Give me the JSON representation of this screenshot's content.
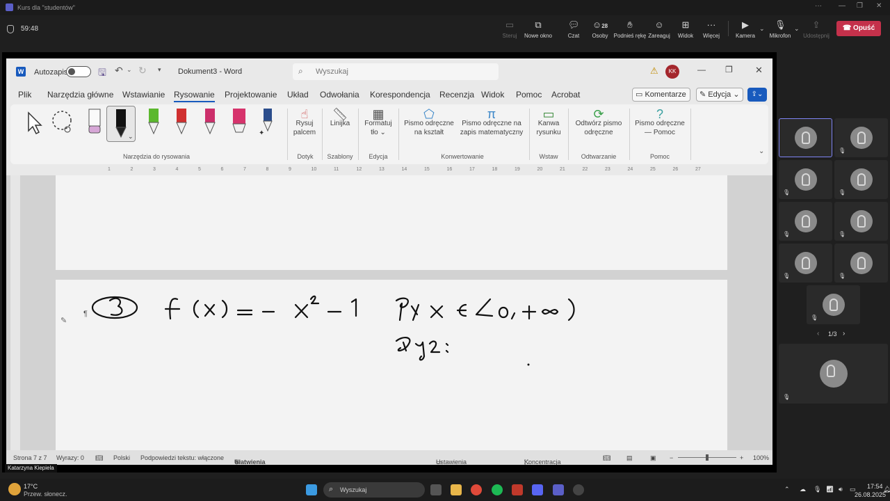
{
  "teams": {
    "window_title": "Kurs dla \"studentów\"",
    "timer": "59:48",
    "buttons": {
      "share": "Steruj",
      "new_window": "Nowe okno",
      "chat": "Czat",
      "people": "Osoby",
      "people_count": "28",
      "raise_hand": "Podnieś rękę",
      "react": "Zareaguj",
      "view": "Widok",
      "more": "Więcej",
      "camera": "Kamera",
      "mic": "Mikrofon",
      "share_tray": "Udostępnij",
      "leave": "Opuść"
    },
    "presenter_name": "Katarzyna Kiepiela",
    "pager": "1/3"
  },
  "word": {
    "autosave_label": "Autozapis",
    "doc_title": "Dokument3",
    "app_name": "Word",
    "search_placeholder": "Wyszukaj",
    "user_initials": "KK",
    "tabs": [
      "Plik",
      "Narzędzia główne",
      "Wstawianie",
      "Rysowanie",
      "Projektowanie",
      "Układ",
      "Odwołania",
      "Korespondencja",
      "Recenzja",
      "Widok",
      "Pomoc",
      "Acrobat"
    ],
    "active_tab": "Rysowanie",
    "comments_button": "Komentarze",
    "editing_button": "Edycja",
    "ribbon": {
      "draw_with_touch": "Rysuj palcem",
      "ruler": "Linijka",
      "format_background": "Formatuj tło",
      "ink_to_shape": "Pismo odręczne na kształt",
      "ink_to_math": "Pismo odręczne na zapis matematyczny",
      "drawing_canvas": "Kanwa rysunku",
      "ink_replay": "Odtwórz pismo odręczne",
      "ink_help": "Pismo odręczne — Pomoc",
      "groups": {
        "drawing_tools": "Narzędzia do rysowania",
        "touch": "Dotyk",
        "stencils": "Szablony",
        "edit": "Edycja",
        "convert": "Konwertowanie",
        "insert": "Wstaw",
        "replay": "Odtwarzanie",
        "help": "Pomoc"
      }
    },
    "ruler_numbers": [
      "1",
      "2",
      "3",
      "4",
      "5",
      "6",
      "7",
      "8",
      "9",
      "10",
      "11",
      "12",
      "13",
      "14",
      "15",
      "16",
      "17",
      "18",
      "19",
      "20",
      "21",
      "22",
      "23",
      "24",
      "25",
      "26",
      "27"
    ],
    "status": {
      "page": "Strona 7 z 7",
      "words": "Wyrazy: 0",
      "language": "Polski",
      "predictions": "Podpowiedzi tekstu: włączone",
      "accessibility": "Ułatwienia dostępu: zbadaj",
      "display_settings": "Ustawienia wyświetlania",
      "focus": "Koncentracja uwagi",
      "zoom": "100%"
    }
  },
  "taskbar": {
    "temperature": "17°C",
    "weather": "Przew. słonecz.",
    "search_placeholder": "Wyszukaj",
    "time": "17:54",
    "date": "26.08.2025"
  },
  "colors": {
    "accent_teams": "#5b5fc7",
    "leave_red": "#c4314b",
    "avatar_red": "#a4262c",
    "word_blue": "#185abd"
  }
}
